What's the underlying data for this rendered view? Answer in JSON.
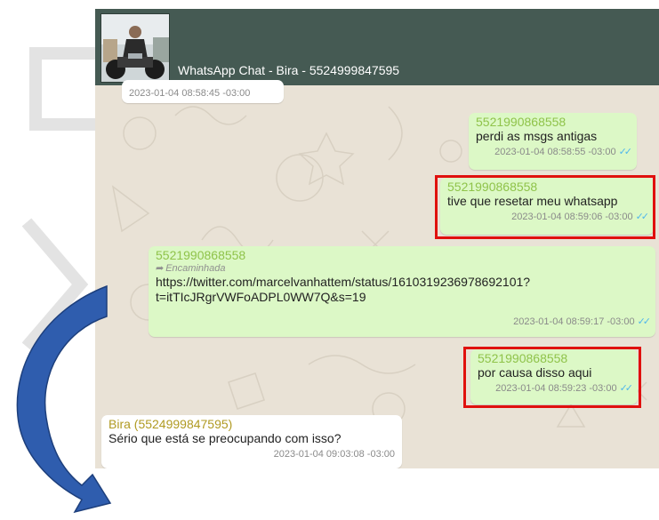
{
  "window": {
    "title": "WhatsApp Chat - Bira - 5524999847595"
  },
  "colors": {
    "header": "#455a53",
    "outgoing_bubble": "#dcf8c6",
    "incoming_bubble": "#ffffff",
    "sender_green": "#8fc34a",
    "sender_bira": "#b09a22",
    "read_ticks": "#4fb6ec",
    "highlight_box": "#e0100e",
    "arrow_fill": "#2f5dae"
  },
  "messages": [
    {
      "direction": "in",
      "timestamp": "2023-01-04 08:58:45 -03:00"
    },
    {
      "direction": "out",
      "sender": "5521990868558",
      "text": "perdi as msgs antigas",
      "timestamp": "2023-01-04 08:58:55 -03:00",
      "status_icon": "double-check-icon"
    },
    {
      "direction": "out",
      "sender": "5521990868558",
      "text": "tive que resetar meu whatsapp",
      "timestamp": "2023-01-04 08:59:06 -03:00",
      "status_icon": "double-check-icon",
      "highlighted": true
    },
    {
      "direction": "out",
      "sender": "5521990868558",
      "forwarded_label": "Encaminhada",
      "text_lines": [
        "https://twitter.com/marcelvanhattem/status/1610319236978692101?",
        "t=itTIcJRgrVWFoADPL0WW7Q&s=19"
      ],
      "timestamp": "2023-01-04 08:59:17 -03:00",
      "status_icon": "double-check-icon"
    },
    {
      "direction": "out",
      "sender": "5521990868558",
      "text": "por causa disso aqui",
      "timestamp": "2023-01-04 08:59:23 -03:00",
      "status_icon": "double-check-icon",
      "highlighted": true
    },
    {
      "direction": "in",
      "sender": "Bira (5524999847595)",
      "text": "Sério que está se preocupando com isso?",
      "timestamp": "2023-01-04 09:03:08 -03:00"
    }
  ],
  "annotations": {
    "arrow_icon": "curved-arrow-icon"
  }
}
